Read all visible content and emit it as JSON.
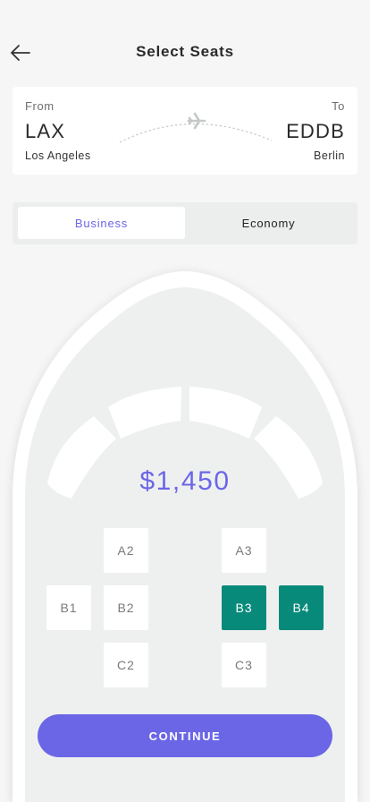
{
  "header": {
    "title": "Select Seats",
    "back_icon": "arrow-left-icon"
  },
  "flight": {
    "from_label": "From",
    "from_code": "LAX",
    "from_city": "Los Angeles",
    "to_label": "To",
    "to_code": "EDDB",
    "to_city": "Berlin",
    "plane_icon": "airplane-icon"
  },
  "class_tabs": [
    {
      "label": "Business",
      "active": true
    },
    {
      "label": "Economy",
      "active": false
    }
  ],
  "price": "$1,450",
  "seats": [
    {
      "id": "A2",
      "selected": false
    },
    {
      "id": "A3",
      "selected": false
    },
    {
      "id": "B1",
      "selected": false
    },
    {
      "id": "B2",
      "selected": false
    },
    {
      "id": "B3",
      "selected": true
    },
    {
      "id": "B4",
      "selected": true
    },
    {
      "id": "C2",
      "selected": false
    },
    {
      "id": "C3",
      "selected": false
    }
  ],
  "continue_label": "CONTINUE",
  "colors": {
    "accent": "#6b66e6",
    "selected_seat": "#088a7a",
    "background": "#f6f6f6"
  }
}
